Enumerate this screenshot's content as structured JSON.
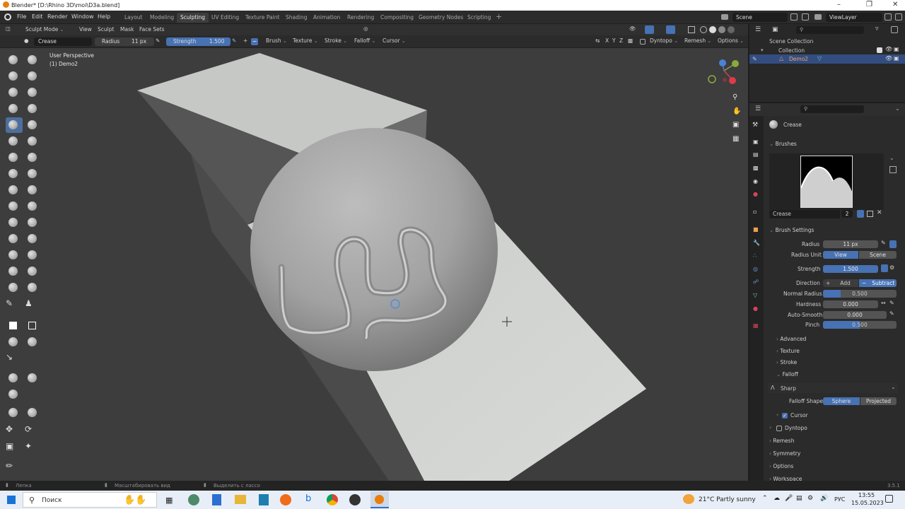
{
  "window": {
    "title": "Blender* [D:\\Rhino 3D\\moi\\D3a.blend]",
    "controls": [
      "–",
      "❐",
      "✕"
    ]
  },
  "menu": [
    "File",
    "Edit",
    "Render",
    "Window",
    "Help"
  ],
  "workspace_tabs": [
    "Layout",
    "Modeling",
    "Sculpting",
    "UV Editing",
    "Texture Paint",
    "Shading",
    "Animation",
    "Rendering",
    "Compositing",
    "Geometry Nodes",
    "Scripting"
  ],
  "active_workspace": "Sculpting",
  "scene": "Scene",
  "view_layer": "ViewLayer",
  "header": {
    "mode": "Sculpt Mode",
    "menus": [
      "View",
      "Sculpt",
      "Mask",
      "Face Sets"
    ],
    "brush_name": "Crease",
    "radius_label": "Radius",
    "radius_value": "11 px",
    "strength_label": "Strength",
    "strength_value": "1.500",
    "dropdowns": [
      "Brush",
      "Texture",
      "Stroke",
      "Falloff",
      "Cursor"
    ],
    "axes": [
      "X",
      "Y",
      "Z"
    ],
    "right_dropdowns": [
      "Dyntopo",
      "Remesh",
      "Options"
    ]
  },
  "viewport": {
    "view_name": "User Perspective",
    "object_label": "(1) Demo2"
  },
  "outliner": {
    "items": [
      "Scene Collection",
      "Collection",
      "Demo2"
    ]
  },
  "properties": {
    "brush_title": "Crease",
    "brushes_label": "Brushes",
    "brush_field": "Crease",
    "brush_users": "2",
    "brush_settings_label": "Brush Settings",
    "radius_label": "Radius",
    "radius_value": "11 px",
    "radius_unit_label": "Radius Unit",
    "radius_unit_view": "View",
    "radius_unit_scene": "Scene",
    "strength_label": "Strength",
    "strength_value": "1.500",
    "strength_fill": 1.0,
    "direction_label": "Direction",
    "direction_add": "Add",
    "direction_subtract": "Subtract",
    "normal_radius_label": "Normal Radius",
    "normal_radius_value": "0.500",
    "hardness_label": "Hardness",
    "hardness_value": "0.000",
    "autosmooth_label": "Auto-Smooth",
    "autosmooth_value": "0.000",
    "pinch_label": "Pinch",
    "pinch_value": "0.500",
    "sections": [
      "Advanced",
      "Texture",
      "Stroke"
    ],
    "falloff_label": "Falloff",
    "falloff_preset": "Sharp",
    "falloff_shape_label": "Falloff Shape",
    "falloff_sphere": "Sphere",
    "falloff_projected": "Projected",
    "cursor_label": "Cursor",
    "dyntopo_label": "Dyntopo",
    "remesh_label": "Remesh",
    "symmetry_label": "Symmetry",
    "options_label": "Options",
    "workspace_label": "Workspace"
  },
  "statusbar": {
    "left": "Лепка",
    "middle": "Масштабировать вид",
    "right_hint": "Выделить с лассо",
    "version": "3.5.1"
  },
  "taskbar": {
    "search": "Поиск",
    "weather": "21°C  Partly sunny",
    "lang": "РУС",
    "time": "13:55",
    "date": "15.05.2023"
  },
  "colors": {
    "accent": "#4772b3",
    "viewport": "#3d3d3d",
    "panel": "#282828"
  }
}
